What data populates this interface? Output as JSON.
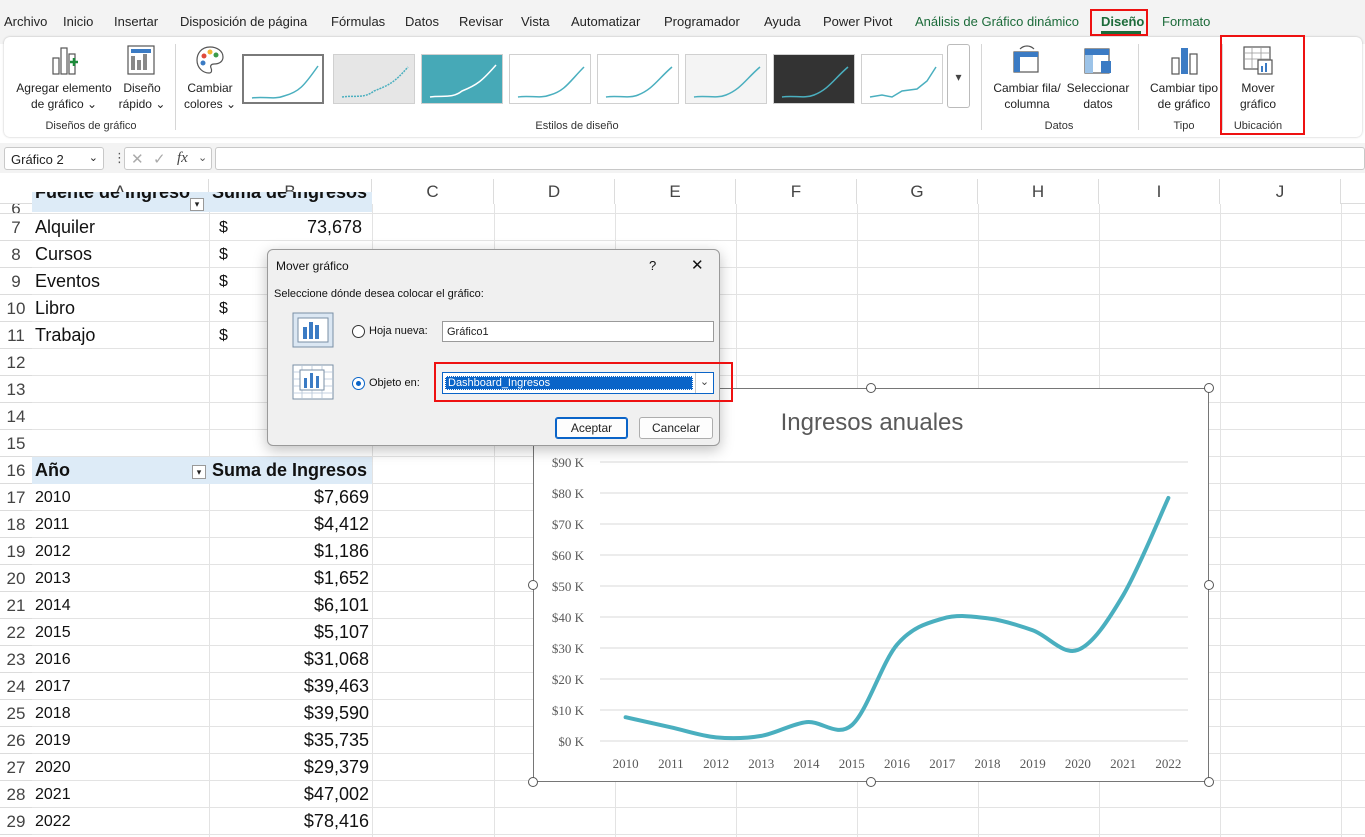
{
  "menu": {
    "items": [
      "Archivo",
      "Inicio",
      "Insertar",
      "Disposición de página",
      "Fórmulas",
      "Datos",
      "Revisar",
      "Vista",
      "Automatizar",
      "Programador",
      "Ayuda",
      "Power Pivot",
      "Análisis de Gráfico dinámico",
      "Diseño",
      "Formato"
    ],
    "active": "Diseño"
  },
  "ribbon": {
    "add_element": "Agregar elemento",
    "add_element_2": "de gráfico",
    "quick_layout": "Diseño",
    "quick_layout_2": "rápido",
    "change_colors": "Cambiar",
    "change_colors_2": "colores",
    "group_layouts": "Diseños de gráfico",
    "group_styles": "Estilos de diseño",
    "switch_row_col": "Cambiar fila/",
    "switch_row_col_2": "columna",
    "select_data": "Seleccionar",
    "select_data_2": "datos",
    "group_data": "Datos",
    "change_type": "Cambiar tipo",
    "change_type_2": "de gráfico",
    "group_type": "Tipo",
    "move_chart": "Mover",
    "move_chart_2": "gráfico",
    "group_location": "Ubicación"
  },
  "formula_bar": {
    "name_box": "Gráfico 2",
    "fx": "fx",
    "value": ""
  },
  "columns": [
    "A",
    "B",
    "C",
    "D",
    "E",
    "F",
    "G",
    "H",
    "I",
    "J"
  ],
  "rows": [
    "6",
    "7",
    "8",
    "9",
    "10",
    "11",
    "12",
    "13",
    "14",
    "15",
    "16",
    "17",
    "18",
    "19",
    "20",
    "21",
    "22",
    "23",
    "24",
    "25",
    "26",
    "27",
    "28",
    "29"
  ],
  "pivot1": {
    "header_a": "Fuente de Ingreso",
    "header_b": "Suma de Ingresos",
    "items": [
      "Alquiler",
      "Cursos",
      "Eventos",
      "Libro",
      "Trabajo"
    ],
    "currency": "$",
    "first_value": "73,678"
  },
  "pivot2": {
    "header_a": "Año",
    "header_b": "Suma de Ingresos",
    "years": [
      "2010",
      "2011",
      "2012",
      "2013",
      "2014",
      "2015",
      "2016",
      "2017",
      "2018",
      "2019",
      "2020",
      "2021",
      "2022"
    ],
    "values": [
      "$7,669",
      "$4,412",
      "$1,186",
      "$1,652",
      "$6,101",
      "$5,107",
      "$31,068",
      "$39,463",
      "$39,590",
      "$35,735",
      "$29,379",
      "$47,002",
      "$78,416"
    ]
  },
  "dialog": {
    "title": "Mover gráfico",
    "help": "?",
    "close": "✕",
    "prompt": "Seleccione dónde desea colocar el gráfico:",
    "new_sheet_label": "Hoja nueva:",
    "new_sheet_value": "Gráfico1",
    "object_in_label": "Objeto en:",
    "object_in_value": "Dashboard_Ingresos",
    "ok": "Aceptar",
    "cancel": "Cancelar"
  },
  "chart_data": {
    "type": "line",
    "title": "Ingresos anuales",
    "categories": [
      "2010",
      "2011",
      "2012",
      "2013",
      "2014",
      "2015",
      "2016",
      "2017",
      "2018",
      "2019",
      "2020",
      "2021",
      "2022"
    ],
    "values": [
      7669,
      4412,
      1186,
      1652,
      6101,
      5107,
      31068,
      39463,
      39590,
      35735,
      29379,
      47002,
      78416
    ],
    "y_ticks": [
      "$0 K",
      "$10 K",
      "$20 K",
      "$30 K",
      "$40 K",
      "$50 K",
      "$60 K",
      "$70 K",
      "$80 K",
      "$90 K"
    ],
    "ylim": [
      0,
      90000
    ],
    "line_color": "#4aafbf",
    "grid": true,
    "smooth": true
  },
  "colors": {
    "accent_green": "#1c6b3a",
    "highlight_red": "#e11111",
    "selection_blue": "#0a64c8"
  }
}
